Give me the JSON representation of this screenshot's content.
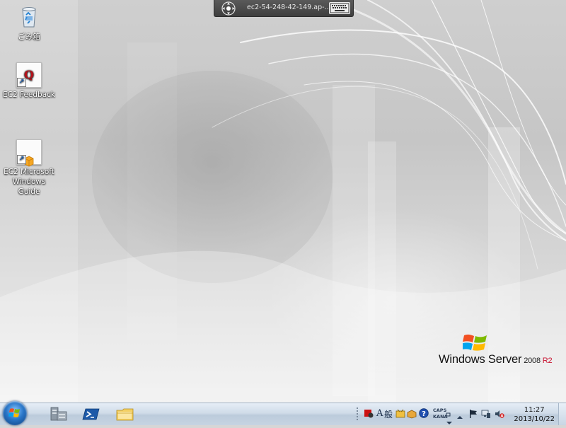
{
  "desktop": {
    "icons": [
      {
        "label": "ごみ箱",
        "icon": "recycle-bin-icon"
      },
      {
        "label": "EC2 Feedback",
        "icon": "feedback-shortcut-icon"
      },
      {
        "label": "EC2 Microsoft\nWindows Guide",
        "icon": "guide-shortcut-icon"
      }
    ]
  },
  "rdp_bar": {
    "title": "ec2-54-248-42-149.ap-..."
  },
  "branding": {
    "product": "Windows Server",
    "version": "2008",
    "edition": "R2"
  },
  "taskbar": {
    "pinned": [
      {
        "name": "server-manager",
        "icon": "server-manager-icon"
      },
      {
        "name": "powershell",
        "icon": "powershell-icon"
      },
      {
        "name": "explorer",
        "icon": "folder-icon"
      }
    ],
    "ime": {
      "mode": "A",
      "mode_label": "般",
      "caps_label": "CAPS",
      "kana_label": "KANA"
    },
    "clock": {
      "time": "11:27",
      "date": "2013/10/22"
    }
  },
  "colors": {
    "taskbar_top": "#e6eef7",
    "taskbar_bottom": "#bccbdb",
    "rdp_bar": "#4a4a4a",
    "accent_red": "#c8102e"
  }
}
